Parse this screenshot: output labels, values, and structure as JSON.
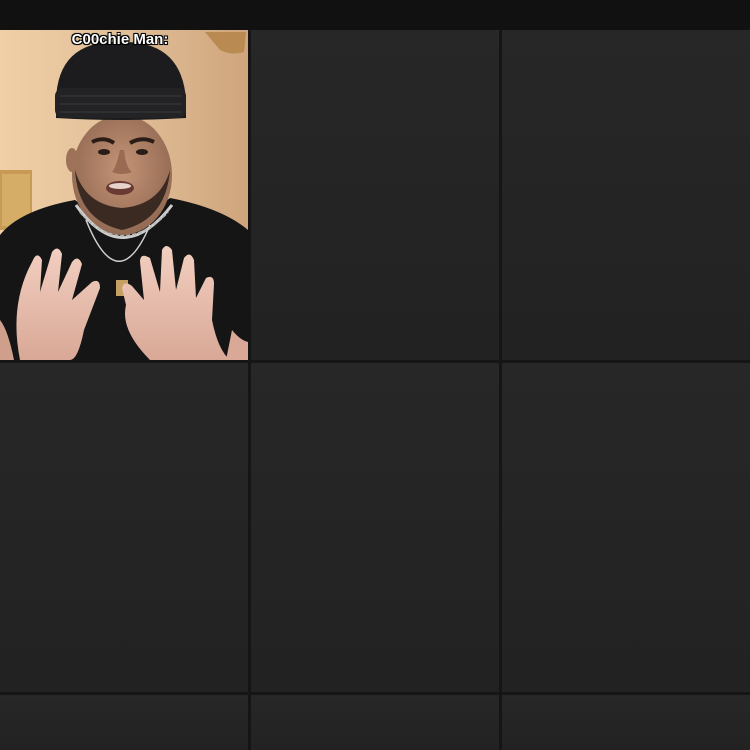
{
  "grid": {
    "tiles": [
      {
        "caption": "C00chie Man:"
      }
    ]
  }
}
